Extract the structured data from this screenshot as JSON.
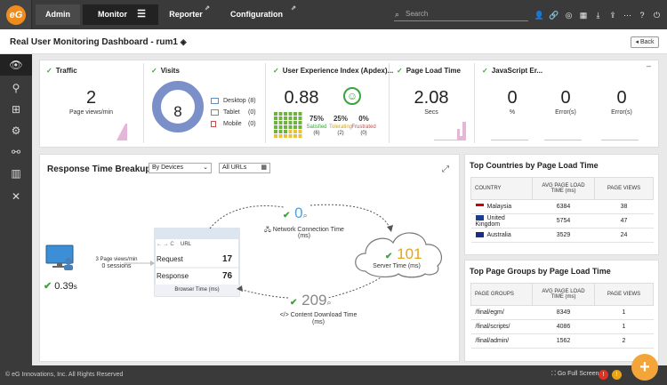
{
  "nav": {
    "admin": "Admin",
    "monitor": "Monitor",
    "reporter": "Reporter",
    "configuration": "Configuration",
    "search_placeholder": "Search"
  },
  "page": {
    "title": "Real User Monitoring Dashboard - rum1",
    "back": "Back"
  },
  "traffic": {
    "title": "Traffic",
    "value": "2",
    "unit": "Page views/min"
  },
  "visits": {
    "title": "Visits",
    "value": "8",
    "devices": [
      {
        "label": "Desktop",
        "count": "(8)"
      },
      {
        "label": "Tablet",
        "count": "(0)"
      },
      {
        "label": "Mobile",
        "count": "(0)"
      }
    ]
  },
  "apdex": {
    "title": "User Experience Index (Apdex)...",
    "value": "0.88",
    "satisfied_pct": "75%",
    "satisfied_label": "Satisfied",
    "satisfied_count": "(6)",
    "tolerating_pct": "25%",
    "tolerating_label": "Tolerating",
    "tolerating_count": "(2)",
    "frustrated_pct": "0%",
    "frustrated_label": "Frustrated",
    "frustrated_count": "(0)"
  },
  "plt": {
    "title": "Page Load Time",
    "value": "2.08",
    "unit": "Secs"
  },
  "js": {
    "title": "JavaScript Er...",
    "v1": "0",
    "u1": "%",
    "v2": "0",
    "u2": "Error(s)",
    "v3": "0",
    "u3": "Error(s)"
  },
  "rtb": {
    "title": "Response Time Breakup",
    "filter1": "By Devices",
    "filter2": "All URLs",
    "sessions_line1": "3 Page views/min",
    "sessions_line2": "0 sessions",
    "client_time": "0.39",
    "client_unit": "s",
    "url_label": "URL",
    "request_label": "Request",
    "request_value": "17",
    "response_label": "Response",
    "response_value": "76",
    "browser_time": "Browser Time (ms)",
    "network_value": "0",
    "network_label1": "Network Connection Time",
    "network_label2": "(ms)",
    "server_value": "101",
    "server_label": "Server Time (ms)",
    "download_value": "209",
    "download_label1": "Content Download Time",
    "download_label2": "(ms)"
  },
  "countries": {
    "title": "Top Countries by Page Load Time",
    "headers": [
      "COUNTRY",
      "AVG PAGE LOAD TIME (ms)",
      "PAGE VIEWS"
    ],
    "rows": [
      {
        "name": "Malaysia",
        "time": "6384",
        "views": "38"
      },
      {
        "name": "United Kingdom",
        "time": "5754",
        "views": "47"
      },
      {
        "name": "Australia",
        "time": "3529",
        "views": "24"
      }
    ]
  },
  "groups": {
    "title": "Top Page Groups by Page Load Time",
    "headers": [
      "PAGE GROUPS",
      "AVG PAGE LOAD TIME (ms)",
      "PAGE VIEWS"
    ],
    "rows": [
      {
        "name": "/final/egm/",
        "time": "8349",
        "views": "1"
      },
      {
        "name": "/final/scripts/",
        "time": "4086",
        "views": "1"
      },
      {
        "name": "/final/admin/",
        "time": "1562",
        "views": "2"
      }
    ]
  },
  "footer": {
    "copyright": "© eG Innovations, Inc. All Rights Reserved",
    "fullscreen": "Go Full Screen"
  },
  "colors": {
    "accent": "#f08c1e",
    "ok": "#3aa53a",
    "donut": "#7b8fc9",
    "server": "#e8a317"
  }
}
